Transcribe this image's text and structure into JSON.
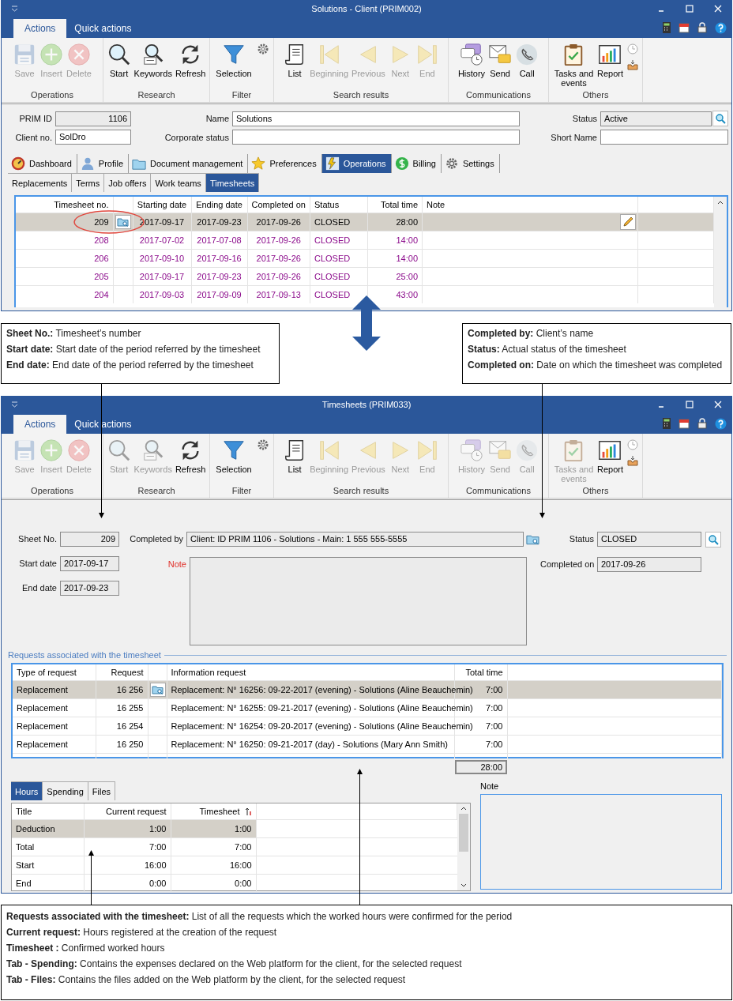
{
  "client_window": {
    "title": "Solutions - Client (PRIM002)",
    "ribbon": {
      "tabs": [
        {
          "label": "Actions",
          "selected": true
        },
        {
          "label": "Quick actions",
          "selected": false
        }
      ],
      "groups": [
        {
          "label": "Operations",
          "buttons": [
            {
              "label": "Save",
              "disabled": true
            },
            {
              "label": "Insert",
              "disabled": true
            },
            {
              "label": "Delete",
              "disabled": true
            }
          ]
        },
        {
          "label": "Research",
          "buttons": [
            {
              "label": "Start",
              "disabled": false
            },
            {
              "label": "Keywords",
              "disabled": false
            },
            {
              "label": "Refresh",
              "disabled": false
            }
          ]
        },
        {
          "label": "Filter",
          "buttons": [
            {
              "label": "Selection",
              "disabled": false
            }
          ]
        },
        {
          "label": "Search results",
          "buttons": [
            {
              "label": "List",
              "disabled": false
            },
            {
              "label": "Beginning",
              "disabled": true
            },
            {
              "label": "Previous",
              "disabled": true
            },
            {
              "label": "Next",
              "disabled": true
            },
            {
              "label": "End",
              "disabled": true
            }
          ]
        },
        {
          "label": "Communications",
          "buttons": [
            {
              "label": "History",
              "disabled": false
            },
            {
              "label": "Send",
              "disabled": false
            },
            {
              "label": "Call",
              "disabled": false
            }
          ]
        },
        {
          "label": "Others",
          "buttons": [
            {
              "label": "Tasks and events",
              "disabled": false
            },
            {
              "label": "Report",
              "disabled": false
            }
          ]
        }
      ]
    },
    "fields": [
      {
        "label": "PRIM ID",
        "value": "1106",
        "readonly": true
      },
      {
        "label": "Name",
        "value": "Solutions",
        "readonly": false
      },
      {
        "label": "Status",
        "value": "Active",
        "readonly": true
      },
      {
        "label": "Client no.",
        "value": "SolDro",
        "readonly": false
      },
      {
        "label": "Corporate status",
        "readonly": false
      },
      {
        "label": "Short Name",
        "readonly": false
      }
    ],
    "tabs": [
      {
        "label": "Dashboard",
        "selected": false
      },
      {
        "label": "Profile",
        "selected": false
      },
      {
        "label": "Document management",
        "selected": false
      },
      {
        "label": "Preferences",
        "selected": false
      },
      {
        "label": "Operations",
        "selected": true
      },
      {
        "label": "Billing",
        "selected": false
      },
      {
        "label": "Settings",
        "selected": false
      }
    ],
    "subtabs": [
      {
        "label": "Replacements",
        "selected": false
      },
      {
        "label": "Terms",
        "selected": false
      },
      {
        "label": "Job offers",
        "selected": false
      },
      {
        "label": "Work teams",
        "selected": false
      },
      {
        "label": "Timesheets",
        "selected": true
      }
    ],
    "table": {
      "columns": [
        "Timesheet no.",
        "Starting date",
        "Ending date",
        "Completed on",
        "Status",
        "Total time",
        "Note"
      ],
      "rows": [
        {
          "cells": [
            "209",
            "2017-09-17",
            "2017-09-23",
            "2017-09-26",
            "CLOSED",
            "28:00"
          ],
          "selected": true
        },
        {
          "cells": [
            "208",
            "2017-07-02",
            "2017-07-08",
            "2017-09-26",
            "CLOSED",
            "14:00"
          ],
          "selected": false
        },
        {
          "cells": [
            "206",
            "2017-09-10",
            "2017-09-16",
            "2017-09-26",
            "CLOSED",
            "14:00"
          ],
          "selected": false
        },
        {
          "cells": [
            "205",
            "2017-09-17",
            "2017-09-23",
            "2017-09-26",
            "CLOSED",
            "25:00"
          ],
          "selected": false
        },
        {
          "cells": [
            "204",
            "2017-09-03",
            "2017-09-09",
            "2017-09-13",
            "CLOSED",
            "43:00"
          ],
          "selected": false
        }
      ]
    }
  },
  "callouts": [
    {
      "lines": [
        "**Sheet No.:** Timesheet’s number",
        "**Start date:** Start date of the period referred by the timesheet",
        "**End date:** End date of the period referred by the timesheet"
      ]
    },
    {
      "lines": [
        "**Completed by:** Client’s name",
        "**Status:** Actual status of the timesheet",
        "**Completed on:** Date on which the timesheet was completed"
      ]
    }
  ],
  "timesheet_window": {
    "title": "Timesheets (PRIM033)",
    "ribbon": {
      "tabs": [
        {
          "label": "Actions",
          "selected": true
        },
        {
          "label": "Quick actions",
          "selected": false
        }
      ],
      "groups": [
        {
          "label": "Operations",
          "buttons": [
            {
              "label": "Save",
              "disabled": true
            },
            {
              "label": "Insert",
              "disabled": true
            },
            {
              "label": "Delete",
              "disabled": true
            }
          ]
        },
        {
          "label": "Research",
          "buttons": [
            {
              "label": "Start",
              "disabled": true
            },
            {
              "label": "Keywords",
              "disabled": true
            },
            {
              "label": "Refresh",
              "disabled": false
            }
          ]
        },
        {
          "label": "Filter",
          "buttons": [
            {
              "label": "Selection",
              "disabled": false
            }
          ]
        },
        {
          "label": "Search results",
          "buttons": [
            {
              "label": "List",
              "disabled": false
            },
            {
              "label": "Beginning",
              "disabled": true
            },
            {
              "label": "Previous",
              "disabled": true
            },
            {
              "label": "Next",
              "disabled": true
            },
            {
              "label": "End",
              "disabled": true
            }
          ]
        },
        {
          "label": "Communications",
          "buttons": [
            {
              "label": "History",
              "disabled": true
            },
            {
              "label": "Send",
              "disabled": true
            },
            {
              "label": "Call",
              "disabled": true
            }
          ]
        },
        {
          "label": "Others",
          "buttons": [
            {
              "label": "Tasks and events",
              "disabled": true
            },
            {
              "label": "Report",
              "disabled": false
            }
          ]
        }
      ]
    },
    "sheet_no": {
      "label": "Sheet No.",
      "value": "209"
    },
    "start_date": {
      "label": "Start date",
      "value": "2017-09-17"
    },
    "end_date": {
      "label": "End date",
      "value": "2017-09-23"
    },
    "completed_by": {
      "label": "Completed by",
      "value": "Client: ID PRIM 1106 - Solutions - Main: 1 555 555-5555"
    },
    "note": {
      "label": "Note"
    },
    "status": {
      "label": "Status",
      "value": "CLOSED"
    },
    "completed_on": {
      "label": "Completed on",
      "value": "2017-09-26"
    },
    "requests": {
      "title": "Requests associated with the timesheet",
      "columns": [
        "Type of request",
        "Request",
        "Information request",
        "Total time"
      ],
      "rows": [
        {
          "cells": [
            "Replacement",
            "16 256",
            "Replacement: N° 16256: 09-22-2017 (evening) - Solutions (Aline Beauchemin)",
            "7:00"
          ],
          "selected": true
        },
        {
          "cells": [
            "Replacement",
            "16 255",
            "Replacement: N° 16255: 09-21-2017 (evening) - Solutions (Aline Beauchemin)",
            "7:00"
          ],
          "selected": false
        },
        {
          "cells": [
            "Replacement",
            "16 254",
            "Replacement: N° 16254: 09-20-2017 (evening) - Solutions (Aline Beauchemin)",
            "7:00"
          ],
          "selected": false
        },
        {
          "cells": [
            "Replacement",
            "16 250",
            "Replacement: N° 16250: 09-21-2017 (day) - Solutions (Mary Ann Smith)",
            "7:00"
          ],
          "selected": false
        }
      ],
      "total": "28:00"
    },
    "tabs": [
      {
        "label": "Hours",
        "selected": true
      },
      {
        "label": "Spending",
        "selected": false
      },
      {
        "label": "Files",
        "selected": false
      }
    ],
    "hours": {
      "columns": [
        "Title",
        "Current request",
        "Timesheet"
      ],
      "rows": [
        {
          "cells": [
            "Deduction",
            "1:00",
            "1:00"
          ],
          "selected": true
        },
        {
          "cells": [
            "Total",
            "7:00",
            "7:00"
          ],
          "selected": false
        },
        {
          "cells": [
            "Start",
            "16:00",
            "16:00"
          ],
          "selected": false
        },
        {
          "cells": [
            "End",
            "0:00",
            "0:00"
          ],
          "selected": false
        }
      ]
    },
    "note_panel": {
      "label": "Note"
    }
  },
  "bottom_callout": {
    "lines": [
      "**Requests associated with the timesheet:** List of all the requests which the worked hours were confirmed for the period",
      "**Current request:** Hours registered at the creation of the request",
      "**Timesheet :** Confirmed worked hours",
      "**Tab - Spending:** Contains the expenses declared on the Web platform for the client, for the selected request",
      "**Tab - Files:** Contains the files added on the Web platform by the client, for the selected request"
    ]
  }
}
